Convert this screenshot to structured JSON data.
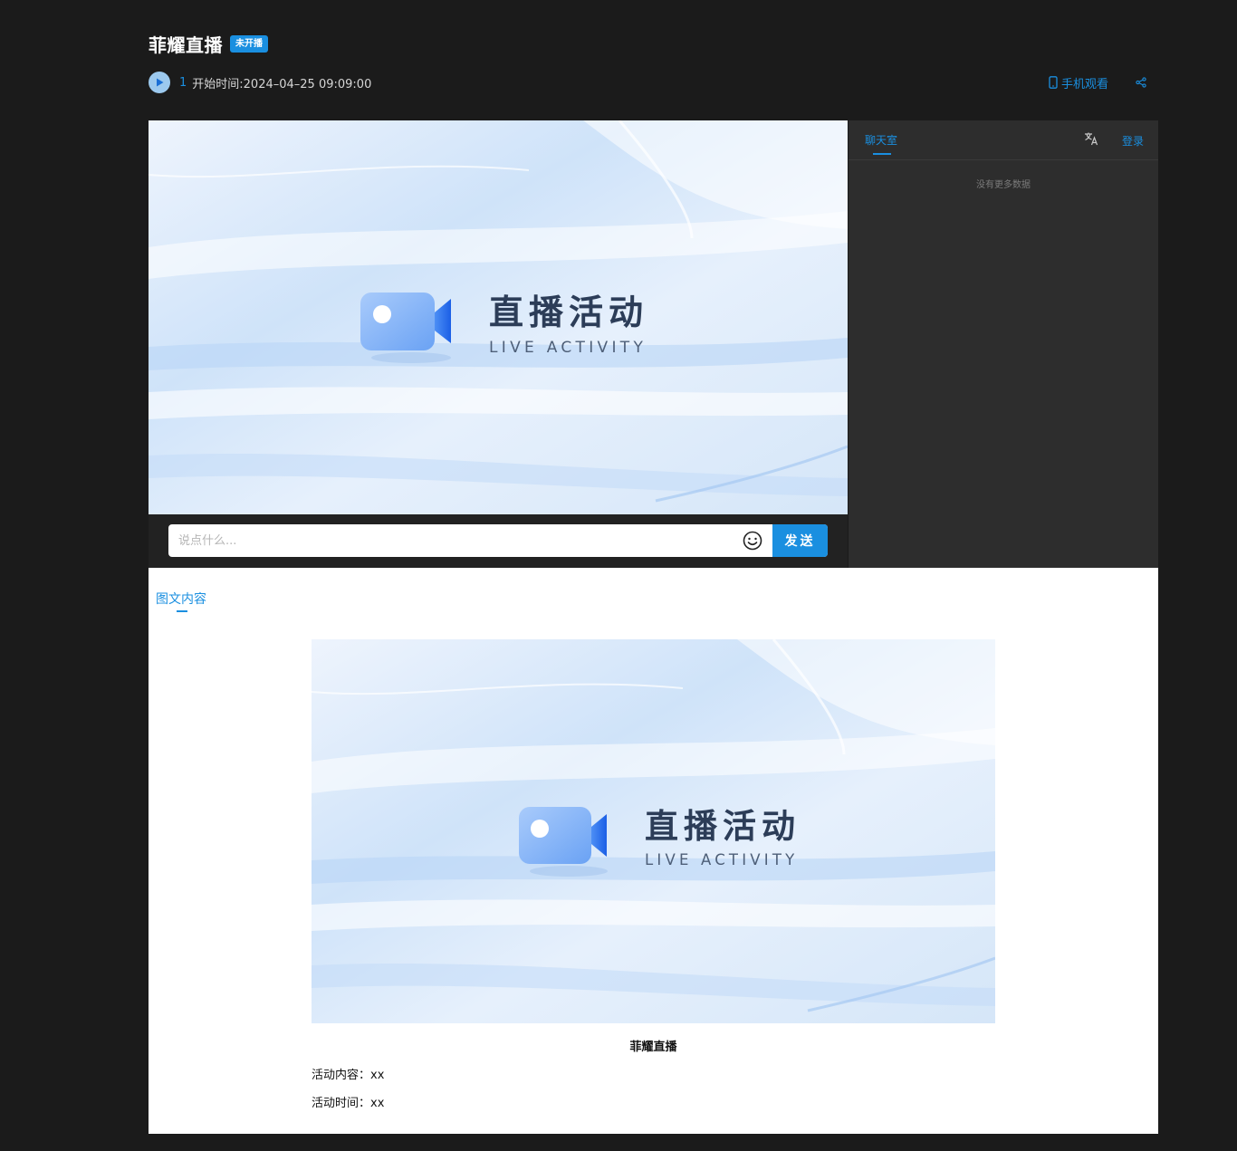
{
  "header": {
    "title": "菲耀直播",
    "status_badge": "未开播",
    "viewer_count": "1",
    "start_time": "开始时间:2024–04–25 09:09:00",
    "mobile_watch_label": "手机观看"
  },
  "player": {
    "brand_cn": "直播活动",
    "brand_en": "LIVE ACTIVITY",
    "chat_placeholder": "说点什么...",
    "send_label": "发送"
  },
  "chat_panel": {
    "tab_label": "聊天室",
    "login_label": "登录",
    "empty_message": "没有更多数据"
  },
  "content": {
    "tab_label": "图文内容",
    "brand_cn": "直播活动",
    "brand_en": "LIVE ACTIVITY",
    "caption": "菲耀直播",
    "line1": "活动内容：xx",
    "line2": "活动时间：xx"
  },
  "colors": {
    "accent": "#1a8fe0",
    "background": "#1b1b1b",
    "chat_panel_bg": "#2d2d2d",
    "player_bg": "#222222"
  },
  "icons": {
    "play": "play-icon",
    "phone": "phone-icon",
    "share": "share-icon",
    "emoji": "emoji-icon",
    "translate": "translate-icon",
    "camera": "video-camera-icon"
  }
}
